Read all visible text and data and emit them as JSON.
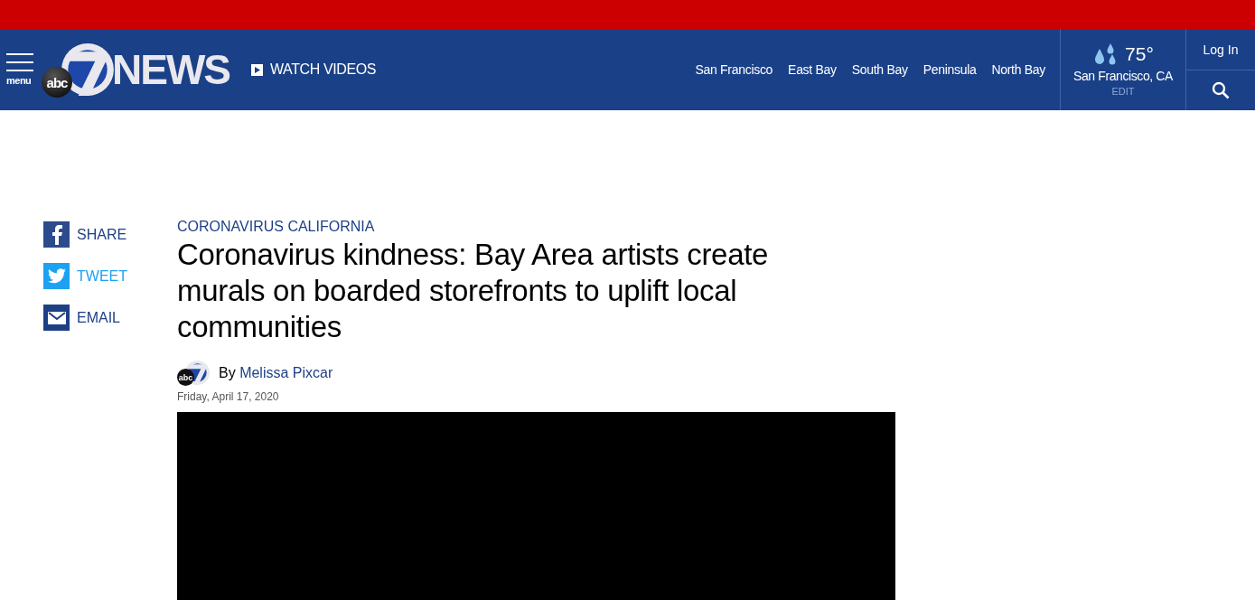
{
  "header": {
    "menu_label": "menu",
    "logo": {
      "badge": "abc",
      "wordmark": "NEWS"
    },
    "watch_videos": "WATCH VIDEOS",
    "regions": [
      "San Francisco",
      "East Bay",
      "South Bay",
      "Peninsula",
      "North Bay"
    ],
    "weather": {
      "temperature": "75°",
      "location": "San Francisco, CA",
      "edit": "EDIT"
    },
    "login": "Log In"
  },
  "share": [
    {
      "kind": "facebook",
      "label": "SHARE"
    },
    {
      "kind": "twitter",
      "label": "TWEET"
    },
    {
      "kind": "email",
      "label": "EMAIL"
    }
  ],
  "article": {
    "category": "CORONAVIRUS CALIFORNIA",
    "headline": "Coronavirus kindness: Bay Area artists create murals on boarded storefronts to uplift local communities",
    "byline": {
      "prefix": "By",
      "author": "Melissa Pixcar",
      "avatar_badge": "abc"
    },
    "date": "Friday, April 17, 2020"
  }
}
